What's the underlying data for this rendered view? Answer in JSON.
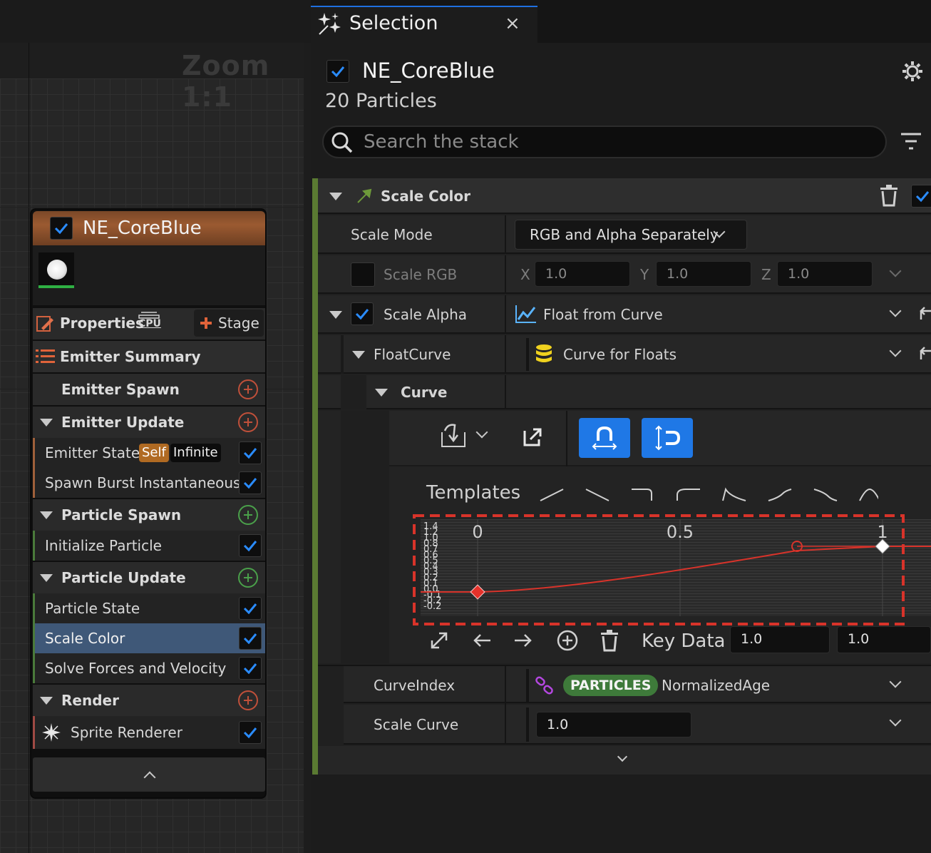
{
  "graph": {
    "zoom_label": "Zoom 1:1",
    "node": {
      "title": "NE_CoreBlue",
      "properties_label": "Properties",
      "cpu_label": "CPU",
      "stage_label": "Stage",
      "summary_label": "Emitter Summary",
      "emitter_spawn": "Emitter Spawn",
      "emitter_update": "Emitter Update",
      "emitter_state": "Emitter State",
      "self_badge": "Self",
      "infinite_badge": "Infinite",
      "spawn_burst": "Spawn Burst Instantaneous",
      "particle_spawn": "Particle Spawn",
      "initialize_particle": "Initialize Particle",
      "particle_update": "Particle Update",
      "particle_state": "Particle State",
      "scale_color": "Scale Color",
      "solve_forces": "Solve Forces and Velocity",
      "render": "Render",
      "sprite_renderer": "Sprite Renderer"
    }
  },
  "panel": {
    "tab_title": "Selection",
    "tab_close": "×",
    "emitter_name": "NE_CoreBlue",
    "particle_count": "20 Particles",
    "search_placeholder": "Search the stack",
    "module_title": "Scale Color",
    "scale_mode_label": "Scale Mode",
    "scale_mode_value": "RGB and Alpha Separately",
    "scale_rgb_label": "Scale RGB",
    "x_label": "X",
    "y_label": "Y",
    "z_label": "Z",
    "rgb_x": "1.0",
    "rgb_y": "1.0",
    "rgb_z": "1.0",
    "scale_alpha_label": "Scale Alpha",
    "scale_alpha_value": "Float from Curve",
    "float_curve_label": "FloatCurve",
    "float_curve_value": "Curve for Floats",
    "curve_label": "Curve",
    "templates_label": "Templates",
    "curve_axis": {
      "x0": "0",
      "x05": "0.5",
      "x1": "1"
    },
    "key_data_label": "Key Data",
    "key_time": "1.0",
    "key_value": "1.0",
    "curve_index_label": "CurveIndex",
    "particles_badge": "PARTICLES",
    "curve_index_value": "NormalizedAge",
    "scale_curve_label": "Scale Curve",
    "scale_curve_value": "1.0"
  },
  "colors": {
    "accent_blue": "#1f78e6",
    "node_header": "#9b5a31",
    "curve_red": "#d8332a",
    "stack_green": "#5a7a32",
    "particles_green": "#3e7a3a"
  }
}
